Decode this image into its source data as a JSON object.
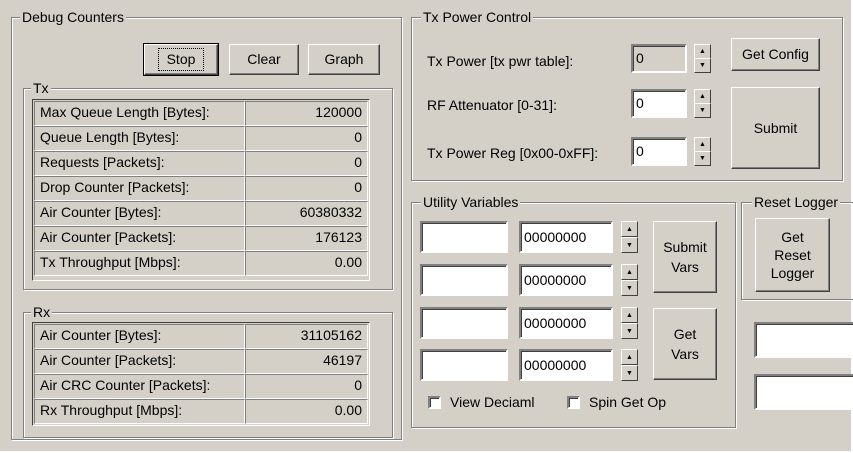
{
  "debug": {
    "title": "Debug Counters",
    "buttons": {
      "stop": "Stop",
      "clear": "Clear",
      "graph": "Graph"
    },
    "tx": {
      "title": "Tx",
      "rows": [
        {
          "label": "Max Queue Length [Bytes]:",
          "value": "120000"
        },
        {
          "label": "Queue Length [Bytes]:",
          "value": "0"
        },
        {
          "label": "Requests [Packets]:",
          "value": "0"
        },
        {
          "label": "Drop Counter [Packets]:",
          "value": "0"
        },
        {
          "label": "Air Counter [Bytes]:",
          "value": "60380332"
        },
        {
          "label": "Air Counter [Packets]:",
          "value": "176123"
        },
        {
          "label": "Tx Throughput [Mbps]:",
          "value": "0.00"
        }
      ]
    },
    "rx": {
      "title": "Rx",
      "rows": [
        {
          "label": "Air Counter [Bytes]:",
          "value": "31105162"
        },
        {
          "label": "Air Counter [Packets]:",
          "value": "46197"
        },
        {
          "label": "Air CRC Counter [Packets]:",
          "value": "0"
        },
        {
          "label": "Rx Throughput [Mbps]:",
          "value": "0.00"
        }
      ]
    }
  },
  "txpower": {
    "title": "Tx Power Control",
    "fields": [
      {
        "label": "Tx Power [tx pwr table]:",
        "value": "0"
      },
      {
        "label": "RF Attenuator [0-31]:",
        "value": "0"
      },
      {
        "label": "Tx Power Reg [0x00-0xFF]:",
        "value": "0"
      }
    ],
    "get_config": "Get Config",
    "submit": "Submit"
  },
  "utility": {
    "title": "Utility Variables",
    "rows": [
      {
        "name": "",
        "value": "00000000"
      },
      {
        "name": "",
        "value": "00000000"
      },
      {
        "name": "",
        "value": "00000000"
      },
      {
        "name": "",
        "value": "00000000"
      }
    ],
    "submit_vars": "Submit Vars",
    "get_vars": "Get Vars",
    "view_decimal": "View Deciaml",
    "spin_get_op": "Spin Get Op"
  },
  "reset": {
    "title": "Reset Logger",
    "button": "Get Reset Logger",
    "field1": "",
    "field2": ""
  },
  "icons": {
    "spin_up": "spin-up-arrow-icon",
    "spin_down": "spin-down-arrow-icon"
  }
}
